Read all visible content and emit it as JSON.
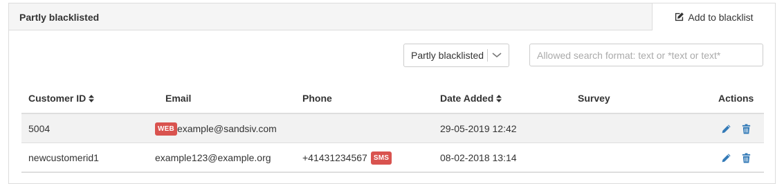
{
  "panel": {
    "title": "Partly blacklisted",
    "add_button_label": "Add to blacklist"
  },
  "filter": {
    "selected": "Partly blacklisted"
  },
  "search": {
    "placeholder": "Allowed search format: text or *text or text*",
    "value": ""
  },
  "table": {
    "columns": {
      "customer_id": "Customer ID",
      "email": "Email",
      "phone": "Phone",
      "date_added": "Date Added",
      "survey": "Survey",
      "actions": "Actions"
    },
    "rows": [
      {
        "customer_id": "5004",
        "email_badge": "WEB",
        "email": "example@sandsiv.com",
        "phone": "",
        "phone_badge": "",
        "date_added": "29-05-2019 12:42",
        "survey": ""
      },
      {
        "customer_id": "newcustomerid1",
        "email_badge": "",
        "email": "example123@example.org",
        "phone": "+41431234567",
        "phone_badge": "SMS",
        "date_added": "08-02-2018 13:14",
        "survey": ""
      }
    ]
  },
  "colors": {
    "badge": "#d9534f",
    "action_icon": "#337ab7",
    "row_highlight": "#f2f2f2"
  },
  "icons": {
    "add": "edit-icon",
    "select": "chevron-down-icon",
    "sort": "sort-icon",
    "edit": "pencil-icon",
    "delete": "trash-icon"
  }
}
